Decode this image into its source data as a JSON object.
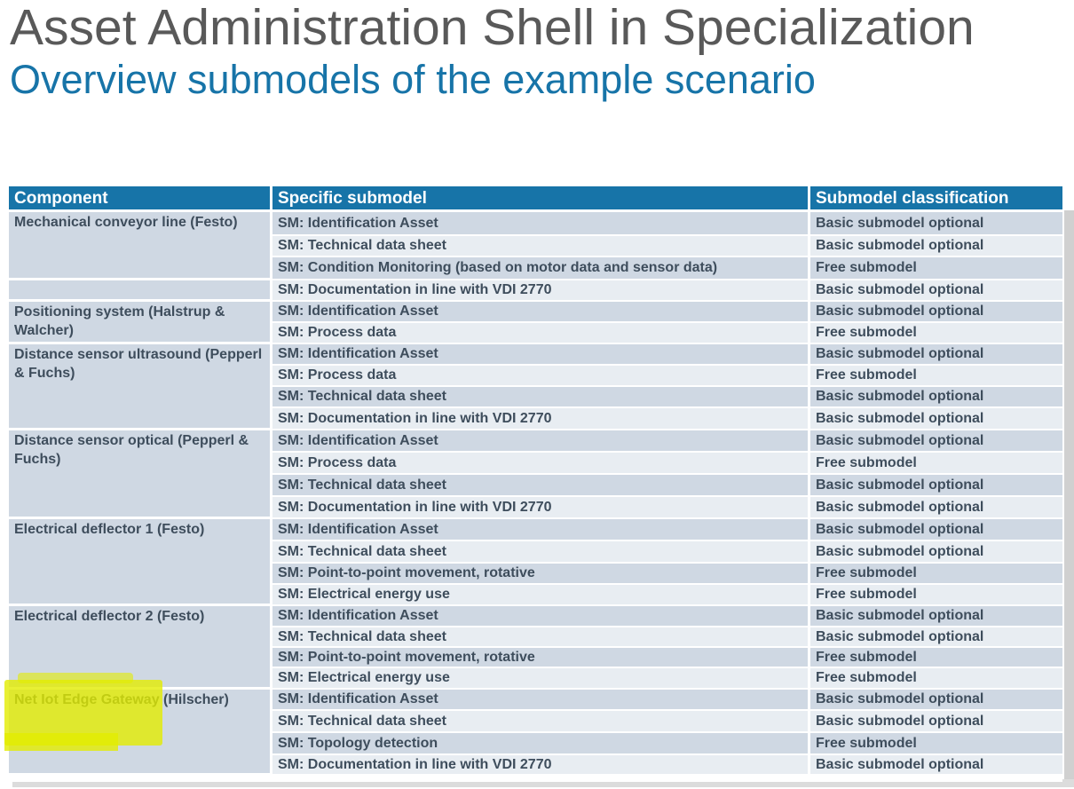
{
  "title": "Asset Administration Shell in Specialization",
  "subtitle": "Overview submodels of the example scenario",
  "table": {
    "headers": [
      "Component",
      "Specific submodel",
      "Submodel classification"
    ],
    "groups": [
      {
        "component": "Mechanical conveyor line (Festo)",
        "rows": [
          [
            "SM: Identification Asset",
            "Basic submodel optional"
          ],
          [
            "SM: Technical data sheet",
            "Basic submodel optional"
          ],
          [
            "SM: Condition Monitoring (based on motor data and sensor data)",
            "Free submodel"
          ]
        ]
      },
      {
        "component": "",
        "rows": [
          [
            "SM: Documentation in line with VDI 2770",
            "Basic submodel optional"
          ]
        ]
      },
      {
        "component": "Positioning system (Halstrup & Walcher)",
        "rows": [
          [
            "SM: Identification Asset",
            "Basic submodel optional"
          ],
          [
            "SM: Process data",
            "Free submodel"
          ]
        ]
      },
      {
        "component": "Distance sensor ultrasound (Pepperl & Fuchs)",
        "rows": [
          [
            "SM: Identification Asset",
            "Basic submodel optional"
          ],
          [
            "SM: Process data",
            "Free submodel"
          ],
          [
            "SM: Technical data sheet",
            "Basic submodel optional"
          ],
          [
            "SM: Documentation in line with VDI 2770",
            "Basic submodel optional"
          ]
        ]
      },
      {
        "component": "Distance sensor optical (Pepperl & Fuchs)",
        "rows": [
          [
            "SM: Identification Asset",
            "Basic submodel optional"
          ],
          [
            "SM: Process data",
            "Free submodel"
          ],
          [
            "SM: Technical data sheet",
            "Basic submodel optional"
          ],
          [
            "SM: Documentation in line with VDI 2770",
            "Basic submodel optional"
          ]
        ]
      },
      {
        "component": "Electrical deflector 1 (Festo)",
        "rows": [
          [
            "SM: Identification Asset",
            "Basic submodel optional"
          ],
          [
            "SM: Technical data sheet",
            "Basic submodel optional"
          ],
          [
            "SM: Point-to-point movement, rotative",
            "Free submodel"
          ],
          [
            "SM: Electrical energy use",
            "Free submodel"
          ]
        ]
      },
      {
        "component": "Electrical deflector 2 (Festo)",
        "rows": [
          [
            "SM: Identification Asset",
            "Basic submodel optional"
          ],
          [
            "SM: Technical data sheet",
            "Basic submodel optional"
          ],
          [
            "SM: Point-to-point movement, rotative",
            "Free submodel"
          ],
          [
            "SM: Electrical energy use",
            "Free submodel"
          ]
        ]
      },
      {
        "component": "Net Iot Edge Gateway (Hilscher)",
        "rows": [
          [
            "SM: Identification Asset",
            "Basic submodel optional"
          ],
          [
            "SM: Technical data sheet",
            "Basic submodel optional"
          ],
          [
            "SM: Topology detection",
            "Free submodel"
          ],
          [
            "SM: Documentation in line with VDI 2770",
            "Basic submodel optional"
          ]
        ]
      }
    ]
  },
  "colors": {
    "header_bg": "#1774a8",
    "row_dark": "#cfd8e3",
    "row_light": "#e8edf2",
    "highlight": "#e2ec00"
  }
}
